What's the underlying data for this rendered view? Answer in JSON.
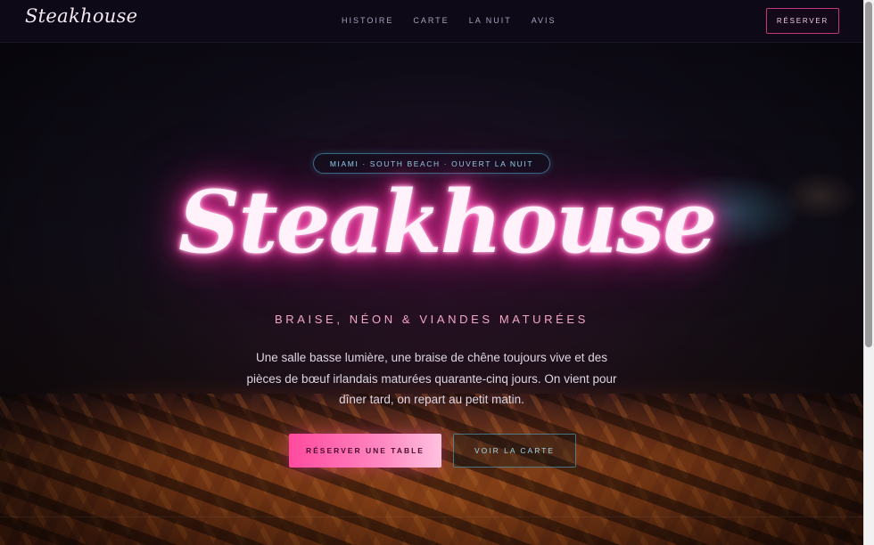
{
  "header": {
    "logo": "Steakhouse",
    "nav": [
      "HISTOIRE",
      "CARTE",
      "LA NUIT",
      "AVIS"
    ],
    "reserve_label": "RÉSERVER"
  },
  "hero": {
    "badge": "MIAMI · SOUTH BEACH · OUVERT LA NUIT",
    "title": "Steakhouse",
    "tagline": "BRAISE, NÉON & VIANDES MATURÉES",
    "intro": "Une salle basse lumière, une braise de chêne toujours vive et des pièces de bœuf irlandais maturées quarante-cinq jours. On vient pour dîner tard, on repart au petit matin.",
    "primary_cta": "RÉSERVER UNE TABLE",
    "secondary_cta": "VOIR LA CARTE"
  },
  "colors": {
    "neon_pink": "#ff3ea8",
    "accent_cyan": "#8ed7ea",
    "background": "#0b0812"
  }
}
